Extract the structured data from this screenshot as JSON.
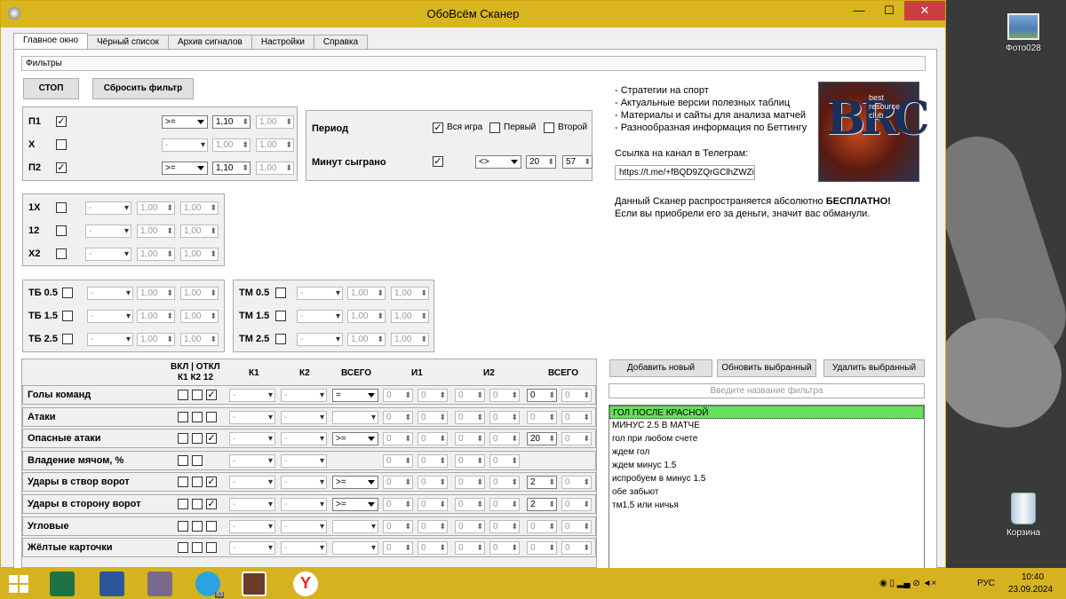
{
  "window": {
    "title": "ОбоВсём Сканер",
    "minimize": "—",
    "maximize": "☐",
    "close": "✕"
  },
  "tabs": [
    "Главное окно",
    "Чёрный список",
    "Архив сигналов",
    "Настройки",
    "Справка"
  ],
  "filters_header": "Фильтры",
  "buttons": {
    "stop": "СТОП",
    "reset": "Сбросить фильтр",
    "add": "Добавить новый",
    "update": "Обновить выбранный",
    "delete": "Удалить выбранный"
  },
  "outcomes": [
    {
      "label": "П1",
      "checked": true,
      "op": ">=",
      "v1": "1,10",
      "v2": "1,00"
    },
    {
      "label": "Х",
      "checked": false,
      "op": "-",
      "v1": "1,00",
      "v2": "1,00"
    },
    {
      "label": "П2",
      "checked": true,
      "op": ">=",
      "v1": "1,10",
      "v2": "1,00"
    }
  ],
  "doubles": [
    {
      "label": "1Х",
      "op": "-",
      "v1": "1,00",
      "v2": "1,00"
    },
    {
      "label": "12",
      "op": "-",
      "v1": "1,00",
      "v2": "1,00"
    },
    {
      "label": "Х2",
      "op": "-",
      "v1": "1,00",
      "v2": "1,00"
    }
  ],
  "period": {
    "label": "Период",
    "options": [
      "Вся игра",
      "Первый",
      "Второй"
    ],
    "checked": [
      true,
      false,
      false
    ]
  },
  "minutes": {
    "label": "Минут сыграно",
    "checked": true,
    "op": "<>",
    "from": "20",
    "to": "57"
  },
  "tb": [
    {
      "label": "ТБ 0.5",
      "op": "-",
      "v1": "1,00",
      "v2": "1,00"
    },
    {
      "label": "ТБ 1.5",
      "op": "-",
      "v1": "1,00",
      "v2": "1,00"
    },
    {
      "label": "ТБ 2.5",
      "op": "-",
      "v1": "1,00",
      "v2": "1,00"
    }
  ],
  "tm": [
    {
      "label": "ТМ 0.5",
      "op": "-",
      "v1": "1,00",
      "v2": "1,00"
    },
    {
      "label": "ТМ 1.5",
      "op": "-",
      "v1": "1,00",
      "v2": "1,00"
    },
    {
      "label": "ТМ 2.5",
      "op": "-",
      "v1": "1,00",
      "v2": "1,00"
    }
  ],
  "info": {
    "lines": [
      "- Стратегии на спорт",
      "- Актуальные версии полезных таблиц",
      "- Материалы и сайты для анализа матчей",
      "- Разнообразная информация по Беттингу"
    ],
    "telegram_label": "Ссылка на канал в Телеграм:",
    "telegram_link": "https://t.me/+fBQD9ZQrGClhZWZi",
    "free_1": "Данный Сканер распространяется абсолютно ",
    "free_bold": "БЕСПЛАТНО!",
    "free_2": "Если вы приобрели его за деньги, значит вас обманули.",
    "logo_letters": "BRC",
    "logo_sub": "best resource club"
  },
  "stats_header": {
    "onoff": "ВКЛ | ОТКЛ",
    "k": "К1 К2 12",
    "k1": "К1",
    "k2": "К2",
    "total": "ВСЕГО",
    "i1": "И1",
    "i2": "И2",
    "total2": "ВСЕГО"
  },
  "stats": [
    {
      "label": "Голы команд",
      "cb": [
        false,
        false,
        true
      ],
      "op": "=",
      "total": "0",
      "a": "0",
      "b": "0",
      "c": "0",
      "d": "0",
      "t2": "0",
      "t2b": "0",
      "on": true
    },
    {
      "label": "Атаки",
      "cb": [
        false,
        false,
        false
      ],
      "op": "",
      "total": "0",
      "a": "0",
      "b": "0",
      "c": "0",
      "d": "0",
      "t2": "0",
      "t2b": "0",
      "on": false
    },
    {
      "label": "Опасные атаки",
      "cb": [
        false,
        false,
        true
      ],
      "op": ">=",
      "total": "0",
      "a": "0",
      "b": "0",
      "c": "0",
      "d": "0",
      "t2": "20",
      "t2b": "0",
      "on": true
    },
    {
      "label": "Владение мячом, %",
      "cb": [
        false,
        false
      ],
      "op": "",
      "total": "",
      "a": "0",
      "b": "0",
      "c": "0",
      "d": "0",
      "t2": "",
      "t2b": "",
      "on": false
    },
    {
      "label": "Удары в створ ворот",
      "cb": [
        false,
        false,
        true
      ],
      "op": ">=",
      "total": "0",
      "a": "0",
      "b": "0",
      "c": "0",
      "d": "0",
      "t2": "2",
      "t2b": "0",
      "on": true
    },
    {
      "label": "Удары в сторону ворот",
      "cb": [
        false,
        false,
        true
      ],
      "op": ">=",
      "total": "0",
      "a": "0",
      "b": "0",
      "c": "0",
      "d": "0",
      "t2": "2",
      "t2b": "0",
      "on": true
    },
    {
      "label": "Угловые",
      "cb": [
        false,
        false,
        false
      ],
      "op": "",
      "total": "0",
      "a": "0",
      "b": "0",
      "c": "0",
      "d": "0",
      "t2": "0",
      "t2b": "0",
      "on": false
    },
    {
      "label": "Жёлтые карточки",
      "cb": [
        false,
        false,
        false
      ],
      "op": "",
      "total": "0",
      "a": "0",
      "b": "0",
      "c": "0",
      "d": "0",
      "t2": "0",
      "t2b": "0",
      "on": false
    }
  ],
  "filter_name_placeholder": "Введите название фильтра",
  "filter_list": [
    "ГОЛ ПОСЛЕ КРАСНОЙ",
    "МИНУС 2.5 В МАТЧЕ",
    "гол при любом счете",
    "ждем гол",
    "ждем минус 1.5",
    "испробуем в минус 1.5",
    "обе забьют",
    "тм1.5  или  ничья"
  ],
  "desktop": {
    "photo_label": "Фото028",
    "bin_label": "Корзина"
  },
  "taskbar": {
    "lang": "РУС",
    "time": "10:40",
    "date": "23.09.2024",
    "telegram_badge": "63"
  }
}
